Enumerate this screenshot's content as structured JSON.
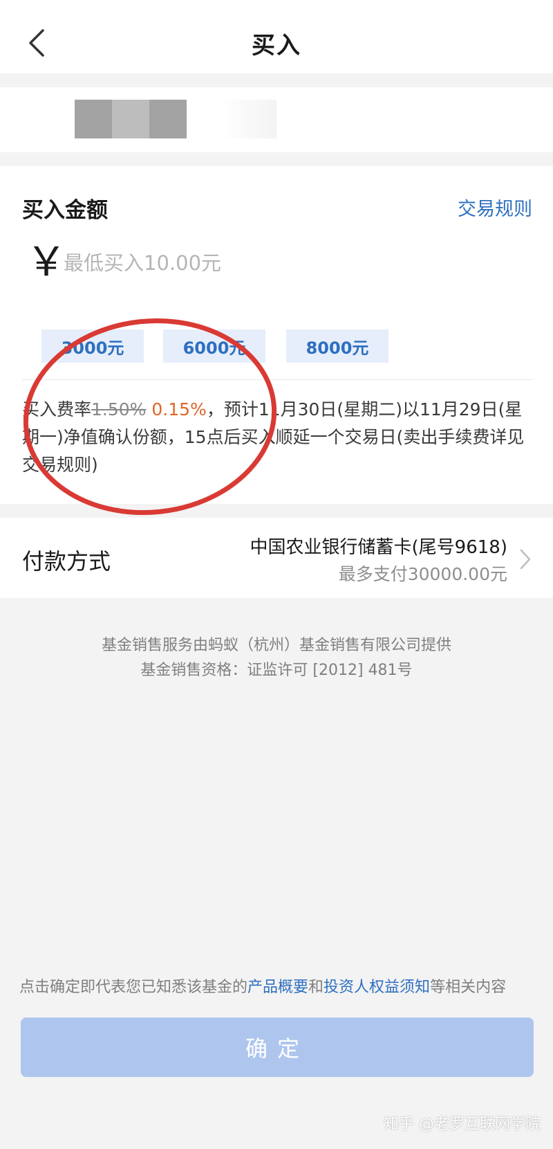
{
  "nav": {
    "title": "买入",
    "back_icon": "chevron-left-icon"
  },
  "buy": {
    "label": "买入金额",
    "rules_link": "交易规则",
    "currency_symbol": "￥",
    "amount_placeholder": "最低买入10.00元",
    "quick_amounts": [
      "3000元",
      "6000元",
      "8000元"
    ],
    "fee_prefix": "买入费率",
    "fee_original": "1.50%",
    "fee_discounted": "0.15%",
    "fee_detail": "，预计11月30日(星期二)以11月29日(星期一)净值确认份额，15点后买入顺延一个交易日(卖出手续费详见交易规则)"
  },
  "payment": {
    "label": "付款方式",
    "bank": "中国农业银行储蓄卡(尾号9618)",
    "limit": "最多支付30000.00元",
    "chevron_icon": "chevron-right-icon"
  },
  "provider": {
    "line1": "基金销售服务由蚂蚁（杭州）基金销售有限公司提供",
    "line2": "基金销售资格：证监许可 [2012] 481号"
  },
  "terms": {
    "prefix": "点击确定即代表您已知悉该基金的",
    "link1": "产品概要",
    "middle": "和",
    "link2": "投资人权益须知",
    "suffix": "等相关内容"
  },
  "confirm_label": "确定",
  "watermark": "知乎 @老罗互联网学院",
  "colors": {
    "accent": "#2e6fbf",
    "fee_highlight": "#e0652a",
    "confirm_disabled": "#aec6ee",
    "chip_bg": "#e6eefb",
    "annotation_circle": "#d93a34"
  }
}
